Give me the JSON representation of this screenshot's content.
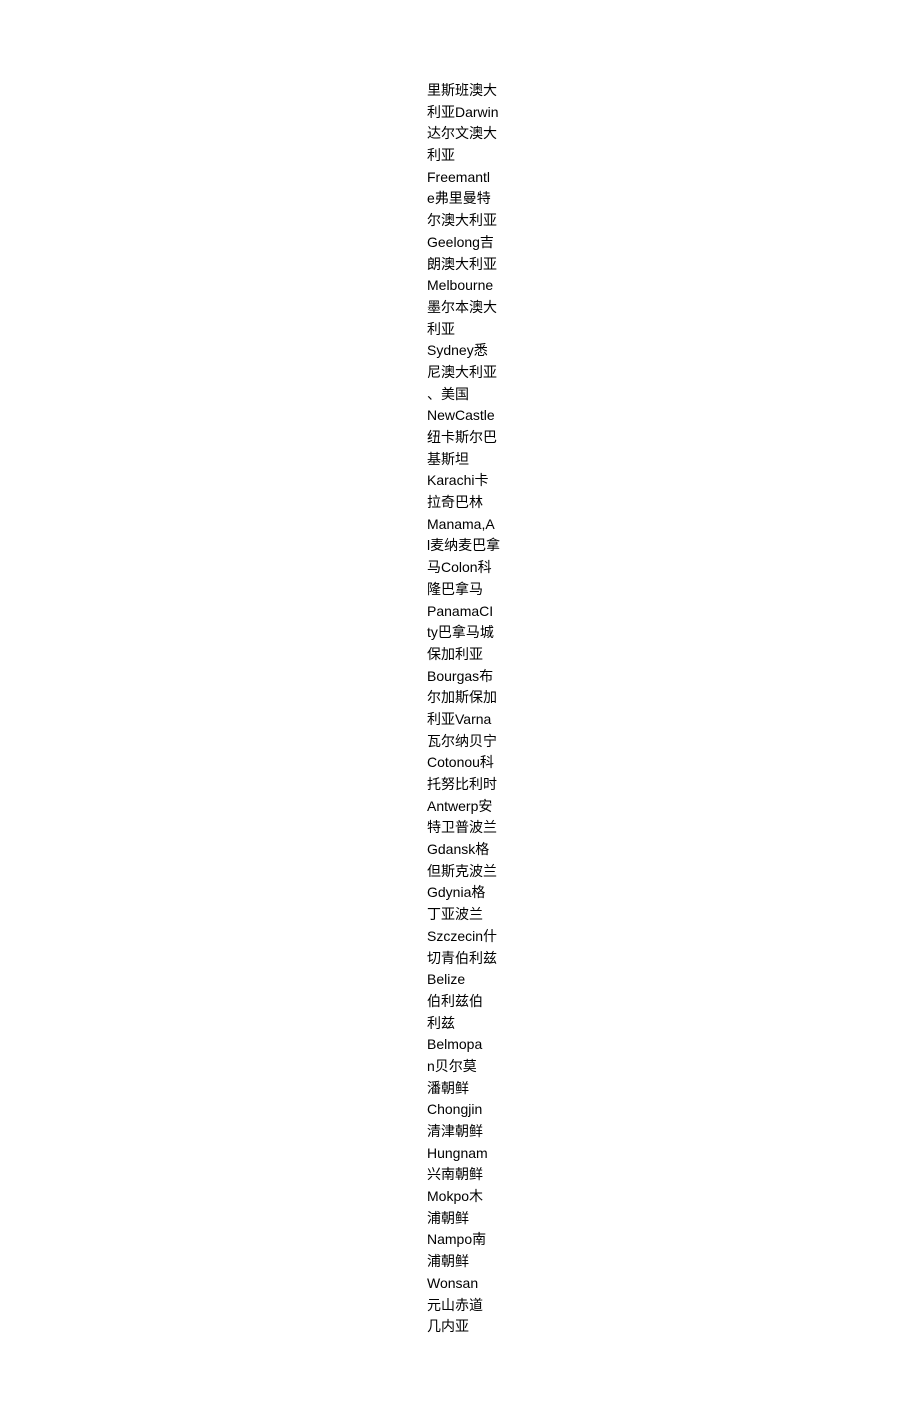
{
  "entries": [
    {
      "id": 1,
      "text": "里斯班澳大利亚Darwin达尔文澳大利亚"
    },
    {
      "id": 2,
      "text": "Fremantle弗里曼特尔澳大利亚"
    },
    {
      "id": 3,
      "text": "Geelong吉朗澳大利亚"
    },
    {
      "id": 4,
      "text": "Melbourne墨尔本澳大利亚"
    },
    {
      "id": 5,
      "text": "Sydney悉尼澳大利亚、美国"
    },
    {
      "id": 6,
      "text": "NewCastle纽卡斯尔巴基斯坦"
    },
    {
      "id": 7,
      "text": "Karachi卡拉奇巴林"
    },
    {
      "id": 8,
      "text": "Manama,Al麦纳麦巴拿马"
    },
    {
      "id": 9,
      "text": "Colon科隆巴拿马"
    },
    {
      "id": 10,
      "text": "PanamaCity巴拿马城保加利亚"
    },
    {
      "id": 11,
      "text": "Bourgas布尔加斯保加利亚"
    },
    {
      "id": 12,
      "text": "Varna瓦尔纳贝宁"
    },
    {
      "id": 13,
      "text": "Cotonou科托努比利时"
    },
    {
      "id": 14,
      "text": "Antwerp安特卫普波兰"
    },
    {
      "id": 15,
      "text": "Gdansk格但斯克波兰"
    },
    {
      "id": 16,
      "text": "Gdynia格丁亚波兰"
    },
    {
      "id": 17,
      "text": "Szczecin什切青伯利兹"
    },
    {
      "id": 18,
      "text": "Belize伯利兹伯利兹"
    },
    {
      "id": 19,
      "text": "Belmopan贝尔莫潘朝鲜"
    },
    {
      "id": 20,
      "text": "Chongjin清津朝鲜"
    },
    {
      "id": 21,
      "text": "Hungnam兴南朝鲜"
    },
    {
      "id": 22,
      "text": "Mokpo木浦朝鲜"
    },
    {
      "id": 23,
      "text": "Nampo南浦朝鲜"
    },
    {
      "id": 24,
      "text": "Wonsan元山赤道几内亚"
    }
  ]
}
